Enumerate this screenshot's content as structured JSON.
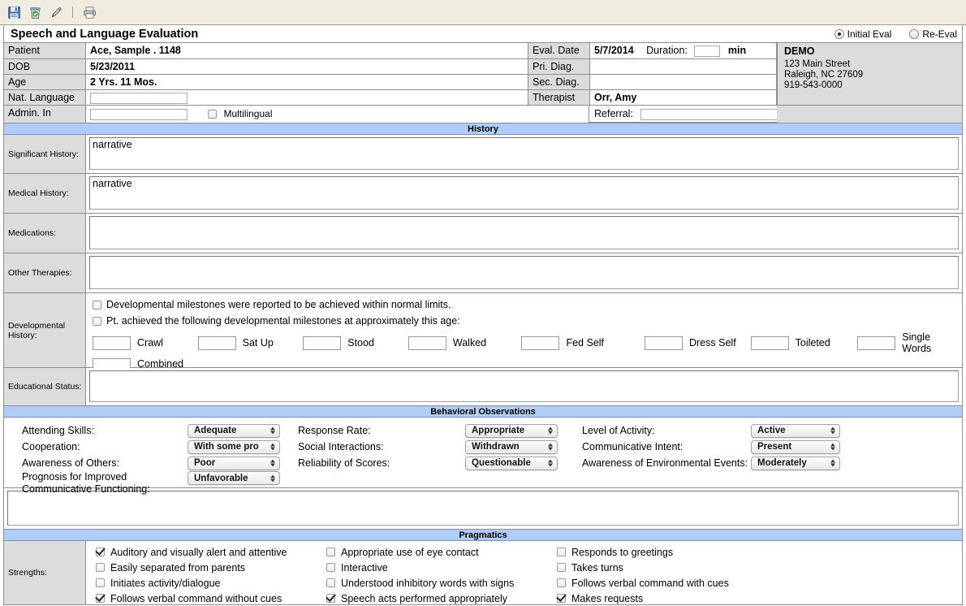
{
  "toolbar": {
    "icons": [
      {
        "name": "save-icon",
        "title": "Save"
      },
      {
        "name": "delete-icon",
        "title": "Delete"
      },
      {
        "name": "edit-pencil-icon",
        "title": "Edit"
      },
      {
        "name": "print-icon",
        "title": "Print"
      }
    ]
  },
  "form": {
    "title": "Speech and Language Evaluation",
    "eval_type": {
      "initial_label": "Initial Eval",
      "reeval_label": "Re-Eval",
      "selected": "Initial Eval"
    },
    "left_fields": [
      {
        "label": "Patient",
        "value": "Ace, Sample .   1148"
      },
      {
        "label": "DOB",
        "value": "5/23/2011"
      },
      {
        "label": "Age",
        "value": "2 Yrs. 11 Mos."
      },
      {
        "label": "Nat. Language",
        "value": ""
      },
      {
        "label": "Admin. In",
        "value": ""
      }
    ],
    "multilingual_label": "Multilingual",
    "multilingual_checked": false,
    "right_fields": [
      {
        "label": "Eval. Date",
        "value": "5/7/2014"
      },
      {
        "label": "Pri. Diag.",
        "value": ""
      },
      {
        "label": "Sec. Diag.",
        "value": ""
      },
      {
        "label": "Therapist",
        "value": "Orr, Amy"
      }
    ],
    "duration_label": "Duration:",
    "duration_value": "",
    "duration_unit": "min",
    "referral_label": "Referral:",
    "referral_value": "",
    "clinic": {
      "name": "DEMO",
      "street": "123 Main Street",
      "city_state_zip": "Raleigh, NC 27609",
      "phone": "919-543-0000"
    }
  },
  "history": {
    "section_title": "History",
    "rows": [
      {
        "label": "Significant History:",
        "value": "narrative"
      },
      {
        "label": "Medical History:",
        "value": "narrative"
      },
      {
        "label": "Medications:",
        "value": ""
      },
      {
        "label": "Other Therapies:",
        "value": ""
      }
    ],
    "developmental": {
      "label": "Developmental History:",
      "check1_label": "Developmental milestones were reported to be achieved within normal limits.",
      "check1_checked": false,
      "check2_label": "Pt. achieved the following developmental milestones at approximately this age:",
      "check2_checked": false,
      "milestones_row1": [
        {
          "label": "Crawl",
          "value": ""
        },
        {
          "label": "Sat Up",
          "value": ""
        },
        {
          "label": "Stood",
          "value": ""
        },
        {
          "label": "Walked",
          "value": ""
        },
        {
          "label": "Fed Self",
          "value": ""
        },
        {
          "label": "Dress Self",
          "value": ""
        },
        {
          "label": "Toileted",
          "value": ""
        },
        {
          "label": "Single Words",
          "value": ""
        }
      ],
      "milestones_row2": [
        {
          "label": "Combined Words",
          "value": ""
        }
      ]
    },
    "educational": {
      "label": "Educational Status:",
      "value": ""
    }
  },
  "behavioral": {
    "section_title": "Behavioral Observations",
    "col1": [
      {
        "label": "Attending Skills:",
        "value": "Adequate"
      },
      {
        "label": "Cooperation:",
        "value": "With some pro"
      },
      {
        "label": "Awareness of Others:",
        "value": "Poor"
      },
      {
        "label": "Prognosis for Improved Communicative Functioning:",
        "value": "Unfavorable"
      }
    ],
    "col2": [
      {
        "label": "Response Rate:",
        "value": "Appropriate"
      },
      {
        "label": "Social Interactions:",
        "value": "Withdrawn"
      },
      {
        "label": "Reliability of Scores:",
        "value": "Questionable"
      }
    ],
    "col3": [
      {
        "label": "Level of Activity:",
        "value": "Active"
      },
      {
        "label": "Communicative Intent:",
        "value": "Present"
      },
      {
        "label": "Awareness of Environmental Events:",
        "value": "Moderately"
      }
    ],
    "notes_value": ""
  },
  "pragmatics": {
    "section_title": "Pragmatics",
    "strengths_label": "Strengths:",
    "rows": [
      [
        {
          "label": "Auditory and visually alert and attentive",
          "checked": true
        },
        {
          "label": "Appropriate use of eye contact",
          "checked": false
        },
        {
          "label": "Responds to greetings",
          "checked": false
        }
      ],
      [
        {
          "label": "Easily separated from parents",
          "checked": false
        },
        {
          "label": "Interactive",
          "checked": false
        },
        {
          "label": "Takes turns",
          "checked": false
        }
      ],
      [
        {
          "label": "Initiates activity/dialogue",
          "checked": false
        },
        {
          "label": "Understood inhibitory words with signs",
          "checked": false
        },
        {
          "label": "Follows verbal command with cues",
          "checked": false
        }
      ],
      [
        {
          "label": "Follows verbal command without cues",
          "checked": true
        },
        {
          "label": "Speech acts performed appropriately",
          "checked": true
        },
        {
          "label": "Makes requests",
          "checked": true
        }
      ]
    ]
  }
}
